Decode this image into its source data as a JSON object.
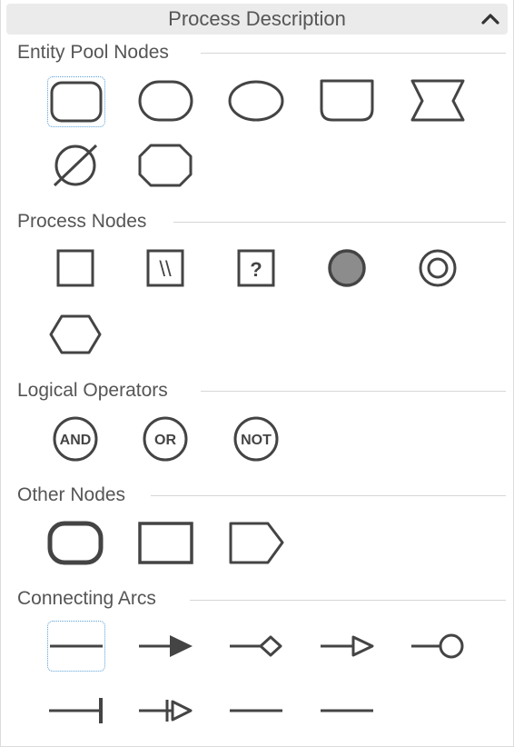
{
  "panel": {
    "title": "Process Description",
    "collapse_icon": "chevron-up-icon"
  },
  "sections": {
    "entity_pool": {
      "title": "Entity Pool Nodes",
      "items": [
        "macromolecule",
        "simple-chemical",
        "unspecified-entity",
        "nucleic-acid-feature",
        "perturbing-agent",
        "source-and-sink",
        "complex"
      ]
    },
    "process": {
      "title": "Process Nodes",
      "items": [
        "process",
        "omitted-process",
        "uncertain-process",
        "association",
        "dissociation",
        "phenotype"
      ],
      "omitted_glyph": "\\\\",
      "uncertain_glyph": "?"
    },
    "logical": {
      "title": "Logical Operators",
      "items": [
        "and",
        "or",
        "not"
      ],
      "and_label": "AND",
      "or_label": "OR",
      "not_label": "NOT"
    },
    "other": {
      "title": "Other Nodes",
      "items": [
        "compartment",
        "submap",
        "tag"
      ]
    },
    "arcs": {
      "title": "Connecting Arcs",
      "items": [
        "consumption",
        "production",
        "modulation",
        "stimulation",
        "catalysis",
        "inhibition",
        "necessary-stimulation",
        "logic-arc",
        "equivalence-arc"
      ]
    }
  },
  "colors": {
    "stroke": "#444444",
    "association_fill": "#8c8c8c",
    "selection": "#5aa0d8",
    "header_bg": "#ebebeb"
  }
}
